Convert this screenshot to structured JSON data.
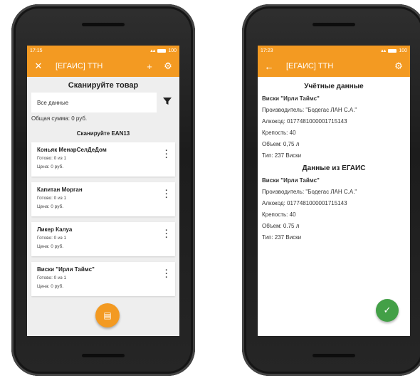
{
  "left": {
    "status": {
      "time": "17:15",
      "battery": "100"
    },
    "appbar": {
      "title": "[ЕГАИС] ТТН",
      "close_icon": "close-icon",
      "add_icon": "plus-icon",
      "settings_icon": "gear-icon"
    },
    "scan_title": "Сканируйте товар",
    "filter": {
      "value": "Все данные",
      "icon": "filter-icon"
    },
    "total": "Общая сумма: 0 руб.",
    "ean_label": "Сканируйте EAN13",
    "items": [
      {
        "name": "Коньяк МенарСелДеДом",
        "ready": "Готово: 0 из 1",
        "price": "Цена: 0 руб."
      },
      {
        "name": "Капитан Морган",
        "ready": "Готово: 0 из 1",
        "price": "Цена: 0 руб."
      },
      {
        "name": "Ликер Калуа",
        "ready": "Готово: 0 из 1",
        "price": "Цена: 0 руб."
      },
      {
        "name": "Виски \"Ирли Таймс\"",
        "ready": "Готово: 0 из 1",
        "price": "Цена: 0 руб."
      }
    ],
    "fab_icon": "barcode-icon"
  },
  "right": {
    "status": {
      "time": "17:23",
      "battery": "100"
    },
    "appbar": {
      "title": "[ЕГАИС] ТТН",
      "back_icon": "arrow-left-icon",
      "settings_icon": "gear-icon"
    },
    "accounting": {
      "title": "Учётные данные",
      "name": "Виски \"Ирли Таймс\"",
      "producer": "Производитель: \"Бодегас ЛАН С.А.\"",
      "alcocode": "Алкокод: 0177481000001715143",
      "strength": "Крепость: 40",
      "volume": "Объем: 0,75 л",
      "type": "Тип: 237 Виски"
    },
    "egais": {
      "title": "Данные из ЕГАИС",
      "name": "Виски \"Ирли Таймс\"",
      "producer": "Производитель: \"Бодегас ЛАН С.А.\"",
      "alcocode": "Алкокод: 0177481000001715143",
      "strength": "Крепость: 40",
      "volume": "Объем: 0.75 л",
      "type": "Тип: 237 Виски"
    },
    "fab_icon": "check-icon"
  },
  "colors": {
    "accent": "#f39a22",
    "confirm": "#43a047"
  }
}
